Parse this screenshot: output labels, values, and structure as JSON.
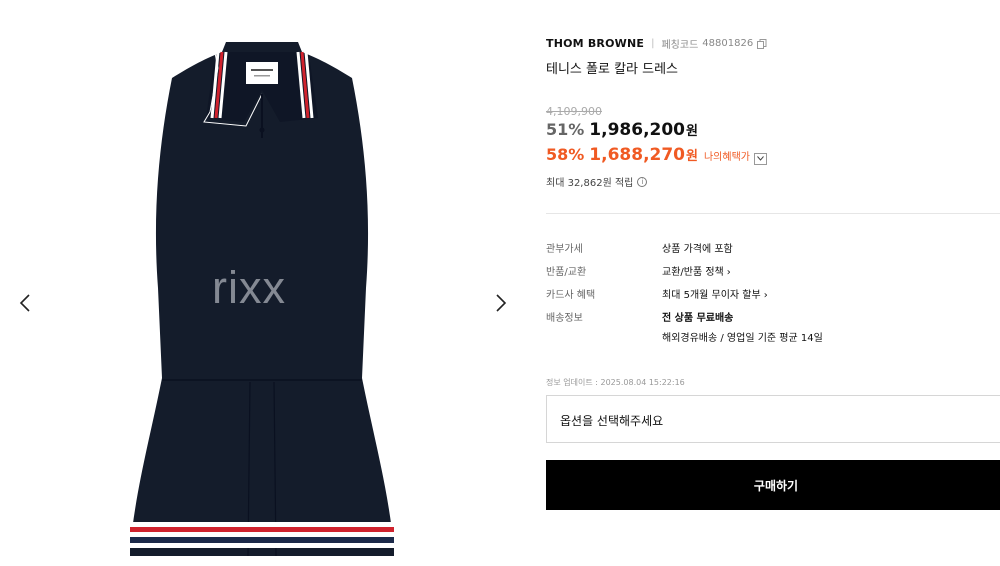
{
  "gallery": {
    "watermark": "rixx",
    "prev_icon": "chevron-left-icon",
    "next_icon": "chevron-right-icon",
    "image_desc": "navy sleeveless polo dress",
    "colors": {
      "dress": "#141c2b",
      "stripe_red": "#d0232e",
      "stripe_white": "#ffffff",
      "stripe_navy": "#1c2a4a"
    }
  },
  "product": {
    "brand": "THOM BROWNE",
    "code_label": "페칭코드",
    "code": "48801826",
    "title": "테니스 폴로 칼라 드레스",
    "original_price": "4,109,900",
    "discount1": "51%",
    "price1": "1,986,200",
    "won": "원",
    "discount2": "58%",
    "price2": "1,688,270",
    "benefit_label": "나의혜택가",
    "points": "최대 32,862원 적립",
    "accent_color": "#f05a23"
  },
  "specs": {
    "duty_label": "관부가세",
    "duty_value": "상품 가격에 포함",
    "return_label": "반품/교환",
    "return_value": "교환/반품 정책",
    "card_label": "카드사 혜택",
    "card_value": "최대 5개월 무이자 할부",
    "shipping_label": "배송정보",
    "shipping_value1": "전 상품 무료배송",
    "shipping_value2": "해외경유배송 / 영업일 기준 평균 14일"
  },
  "updated": "정보 업데이트 : 2025.08.04 15:22:16",
  "option_placeholder": "옵션을 선택해주세요",
  "buy_label": "구매하기"
}
